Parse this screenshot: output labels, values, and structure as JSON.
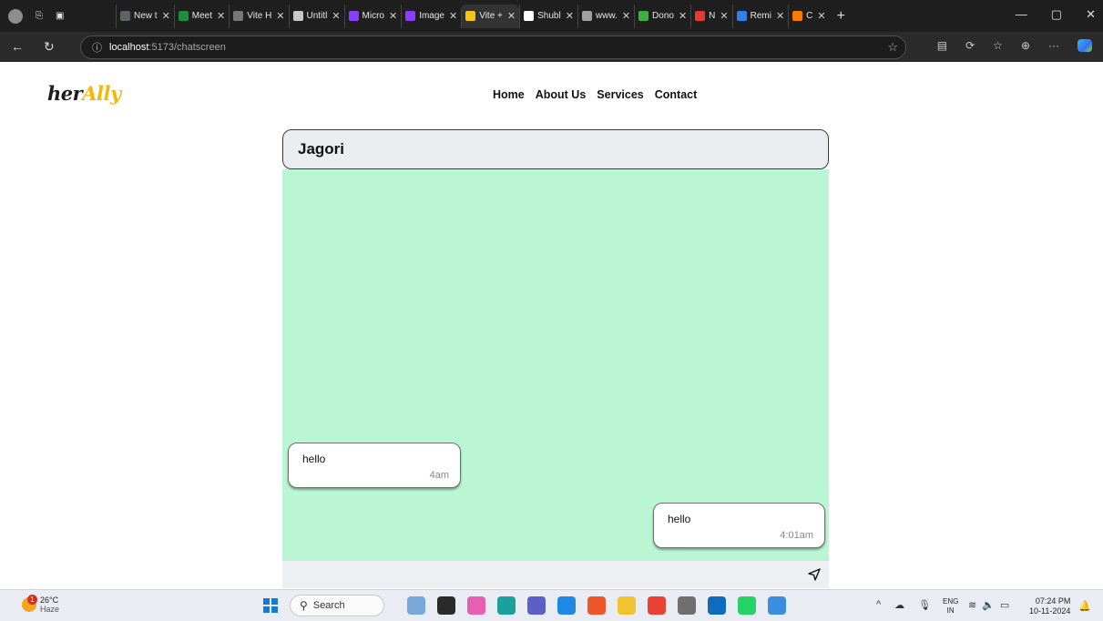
{
  "browser": {
    "tabs": [
      {
        "label": "New t",
        "color": "#5f6368"
      },
      {
        "label": "Meet",
        "color": "#1e8e3e"
      },
      {
        "label": "Vite H",
        "color": "#777777"
      },
      {
        "label": "Untitl",
        "color": "#c8c8c8"
      },
      {
        "label": "Micro",
        "color": "#8a3ffc"
      },
      {
        "label": "Image",
        "color": "#8a3ffc"
      },
      {
        "label": "Vite +",
        "color": "#f5c518",
        "active": true
      },
      {
        "label": "Shubl",
        "color": "#ffffff"
      },
      {
        "label": "www.",
        "color": "#a0a0a0"
      },
      {
        "label": "Dono",
        "color": "#3cb043"
      },
      {
        "label": "N",
        "color": "#e53935"
      },
      {
        "label": "Remi",
        "color": "#2f80ed"
      },
      {
        "label": "C",
        "color": "#f57c00"
      }
    ],
    "url_host": "localhost",
    "url_path": ":5173/chatscreen"
  },
  "site": {
    "logo_part1": "her",
    "logo_part2": "Ally",
    "nav": [
      "Home",
      "About Us",
      "Services",
      "Contact"
    ]
  },
  "chat": {
    "title": "Jagori",
    "messages": [
      {
        "text": "hello",
        "time": "4am",
        "side": "left"
      },
      {
        "text": "hello",
        "time": "4:01am",
        "side": "right"
      }
    ],
    "input_value": ""
  },
  "taskbar": {
    "temperature": "26°C",
    "condition": "Haze",
    "weather_badge": "1",
    "search_placeholder": "Search",
    "lang_top": "ENG",
    "lang_bottom": "IN",
    "time": "07:24 PM",
    "date": "10-11-2024",
    "apps": [
      {
        "name": "paint-app-icon",
        "color": "#7aa7d9"
      },
      {
        "name": "file-manager-app-icon",
        "color": "#2b2b2b"
      },
      {
        "name": "copilot-app-icon",
        "color": "#e85fb1"
      },
      {
        "name": "edge-app-icon",
        "color": "#1aa19b"
      },
      {
        "name": "teams-app-icon",
        "color": "#5b5fc7"
      },
      {
        "name": "vscode-app-icon",
        "color": "#1e88e5"
      },
      {
        "name": "brave-app-icon",
        "color": "#f1562b"
      },
      {
        "name": "file-explorer-app-icon",
        "color": "#f2c230"
      },
      {
        "name": "chrome-app-icon",
        "color": "#e94235"
      },
      {
        "name": "chatgpt-app-icon",
        "color": "#6f6f6f"
      },
      {
        "name": "outlook-app-icon",
        "color": "#0f6cbd"
      },
      {
        "name": "whatsapp-app-icon",
        "color": "#25d366"
      },
      {
        "name": "photos-app-icon",
        "color": "#3a8de0"
      }
    ]
  }
}
